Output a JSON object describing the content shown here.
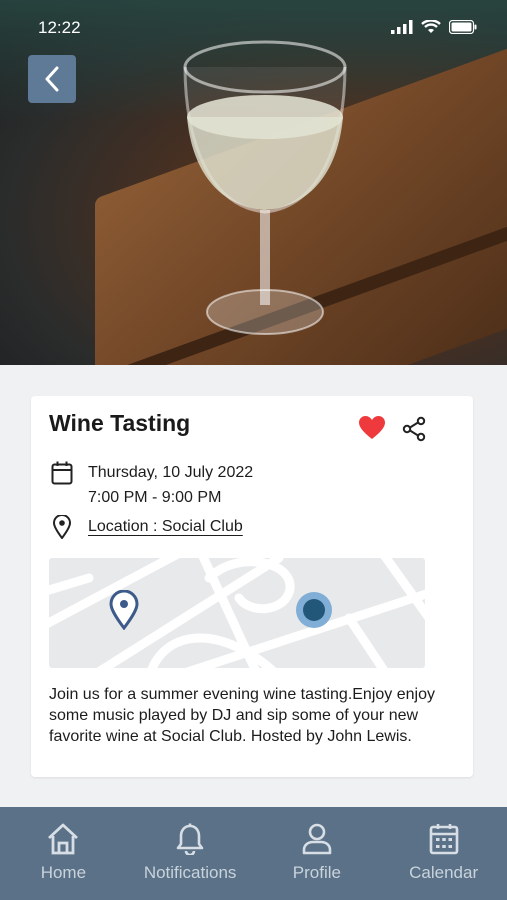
{
  "status_bar": {
    "time": "12:22"
  },
  "event": {
    "title": "Wine Tasting",
    "date": "Thursday, 10 July 2022",
    "time": "7:00 PM - 9:00 PM",
    "location": "Location : Social Club",
    "description": "Join us for a summer evening wine tasting.Enjoy enjoy some music played by DJ and sip some of your new favorite wine at Social Club. Hosted by John Lewis."
  },
  "colors": {
    "heart": "#ef3a3d",
    "tabbar": "#5a7187",
    "back_button": "#5f7a96",
    "map_pin": "#3d5b8a",
    "map_dot": "#2b5f87"
  },
  "tabs": [
    {
      "label": "Home",
      "icon": "home-icon"
    },
    {
      "label": "Notifications",
      "icon": "bell-icon"
    },
    {
      "label": "Profile",
      "icon": "user-icon"
    },
    {
      "label": "Calendar",
      "icon": "calendar-icon"
    }
  ]
}
